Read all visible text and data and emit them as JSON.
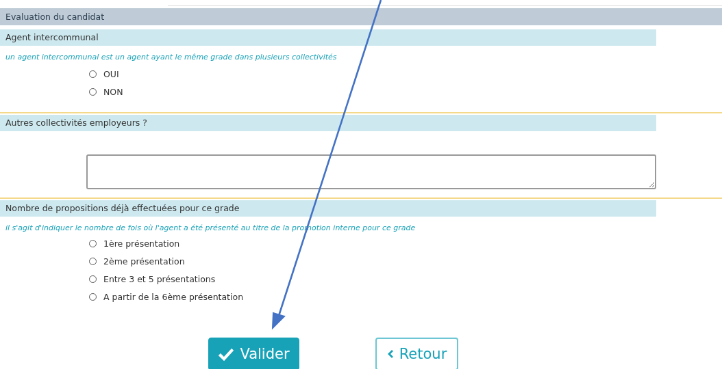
{
  "section_title": "Evaluation du candidat",
  "questions": [
    {
      "kind": "radio",
      "label": "Agent intercommunal",
      "hint": "un agent intercommunal est un agent ayant le même grade dans plusieurs collectivités",
      "options": [
        {
          "label": "OUI",
          "selected": false
        },
        {
          "label": "NON",
          "selected": false
        }
      ]
    },
    {
      "kind": "textarea",
      "label": "Autres collectivités employeurs ?"
    },
    {
      "kind": "radio",
      "label": "Nombre de propositions déjà effectuées pour ce grade",
      "hint": "il s'agit d'indiquer le nombre de fois où l'agent a été présenté au titre de la promotion interne pour ce grade",
      "options": [
        {
          "label": "1ère présentation",
          "selected": false
        },
        {
          "label": "2ème présentation",
          "selected": false
        },
        {
          "label": "Entre 3 et 5 présentations",
          "selected": false
        },
        {
          "label": "A partir de la 6ème présentation",
          "selected": false
        }
      ]
    }
  ],
  "buttons": [
    {
      "kind": "primary",
      "label": "Valider"
    },
    {
      "kind": "back",
      "label": "Retour"
    }
  ]
}
